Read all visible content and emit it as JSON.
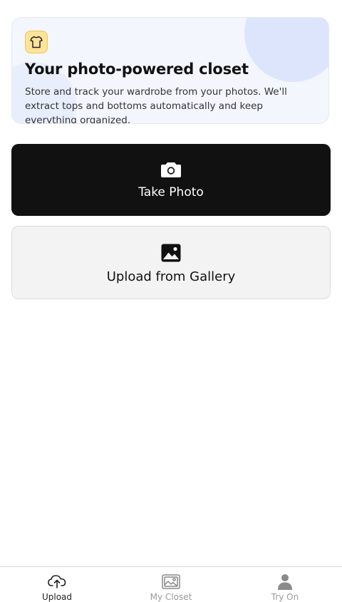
{
  "hero": {
    "title": "Your photo-powered closet",
    "description": "Store and track your wardrobe from your photos. We'll extract tops and bottoms automatically and keep everything organized.",
    "icon": "tshirt-icon"
  },
  "actions": {
    "camera": {
      "label": "Take Photo",
      "icon": "camera-icon"
    },
    "gallery": {
      "label": "Upload from Gallery",
      "icon": "image-icon"
    }
  },
  "tabs": [
    {
      "label": "Upload",
      "icon": "upload-cloud-icon",
      "active": true
    },
    {
      "label": "My Closet",
      "icon": "images-icon",
      "active": false
    },
    {
      "label": "Try On",
      "icon": "person-icon",
      "active": false
    }
  ],
  "colors": {
    "primary_button": "#111111",
    "hero_background": "#f3f6fd",
    "hero_icon_background": "#fde39a",
    "inactive_tab": "#999999"
  }
}
